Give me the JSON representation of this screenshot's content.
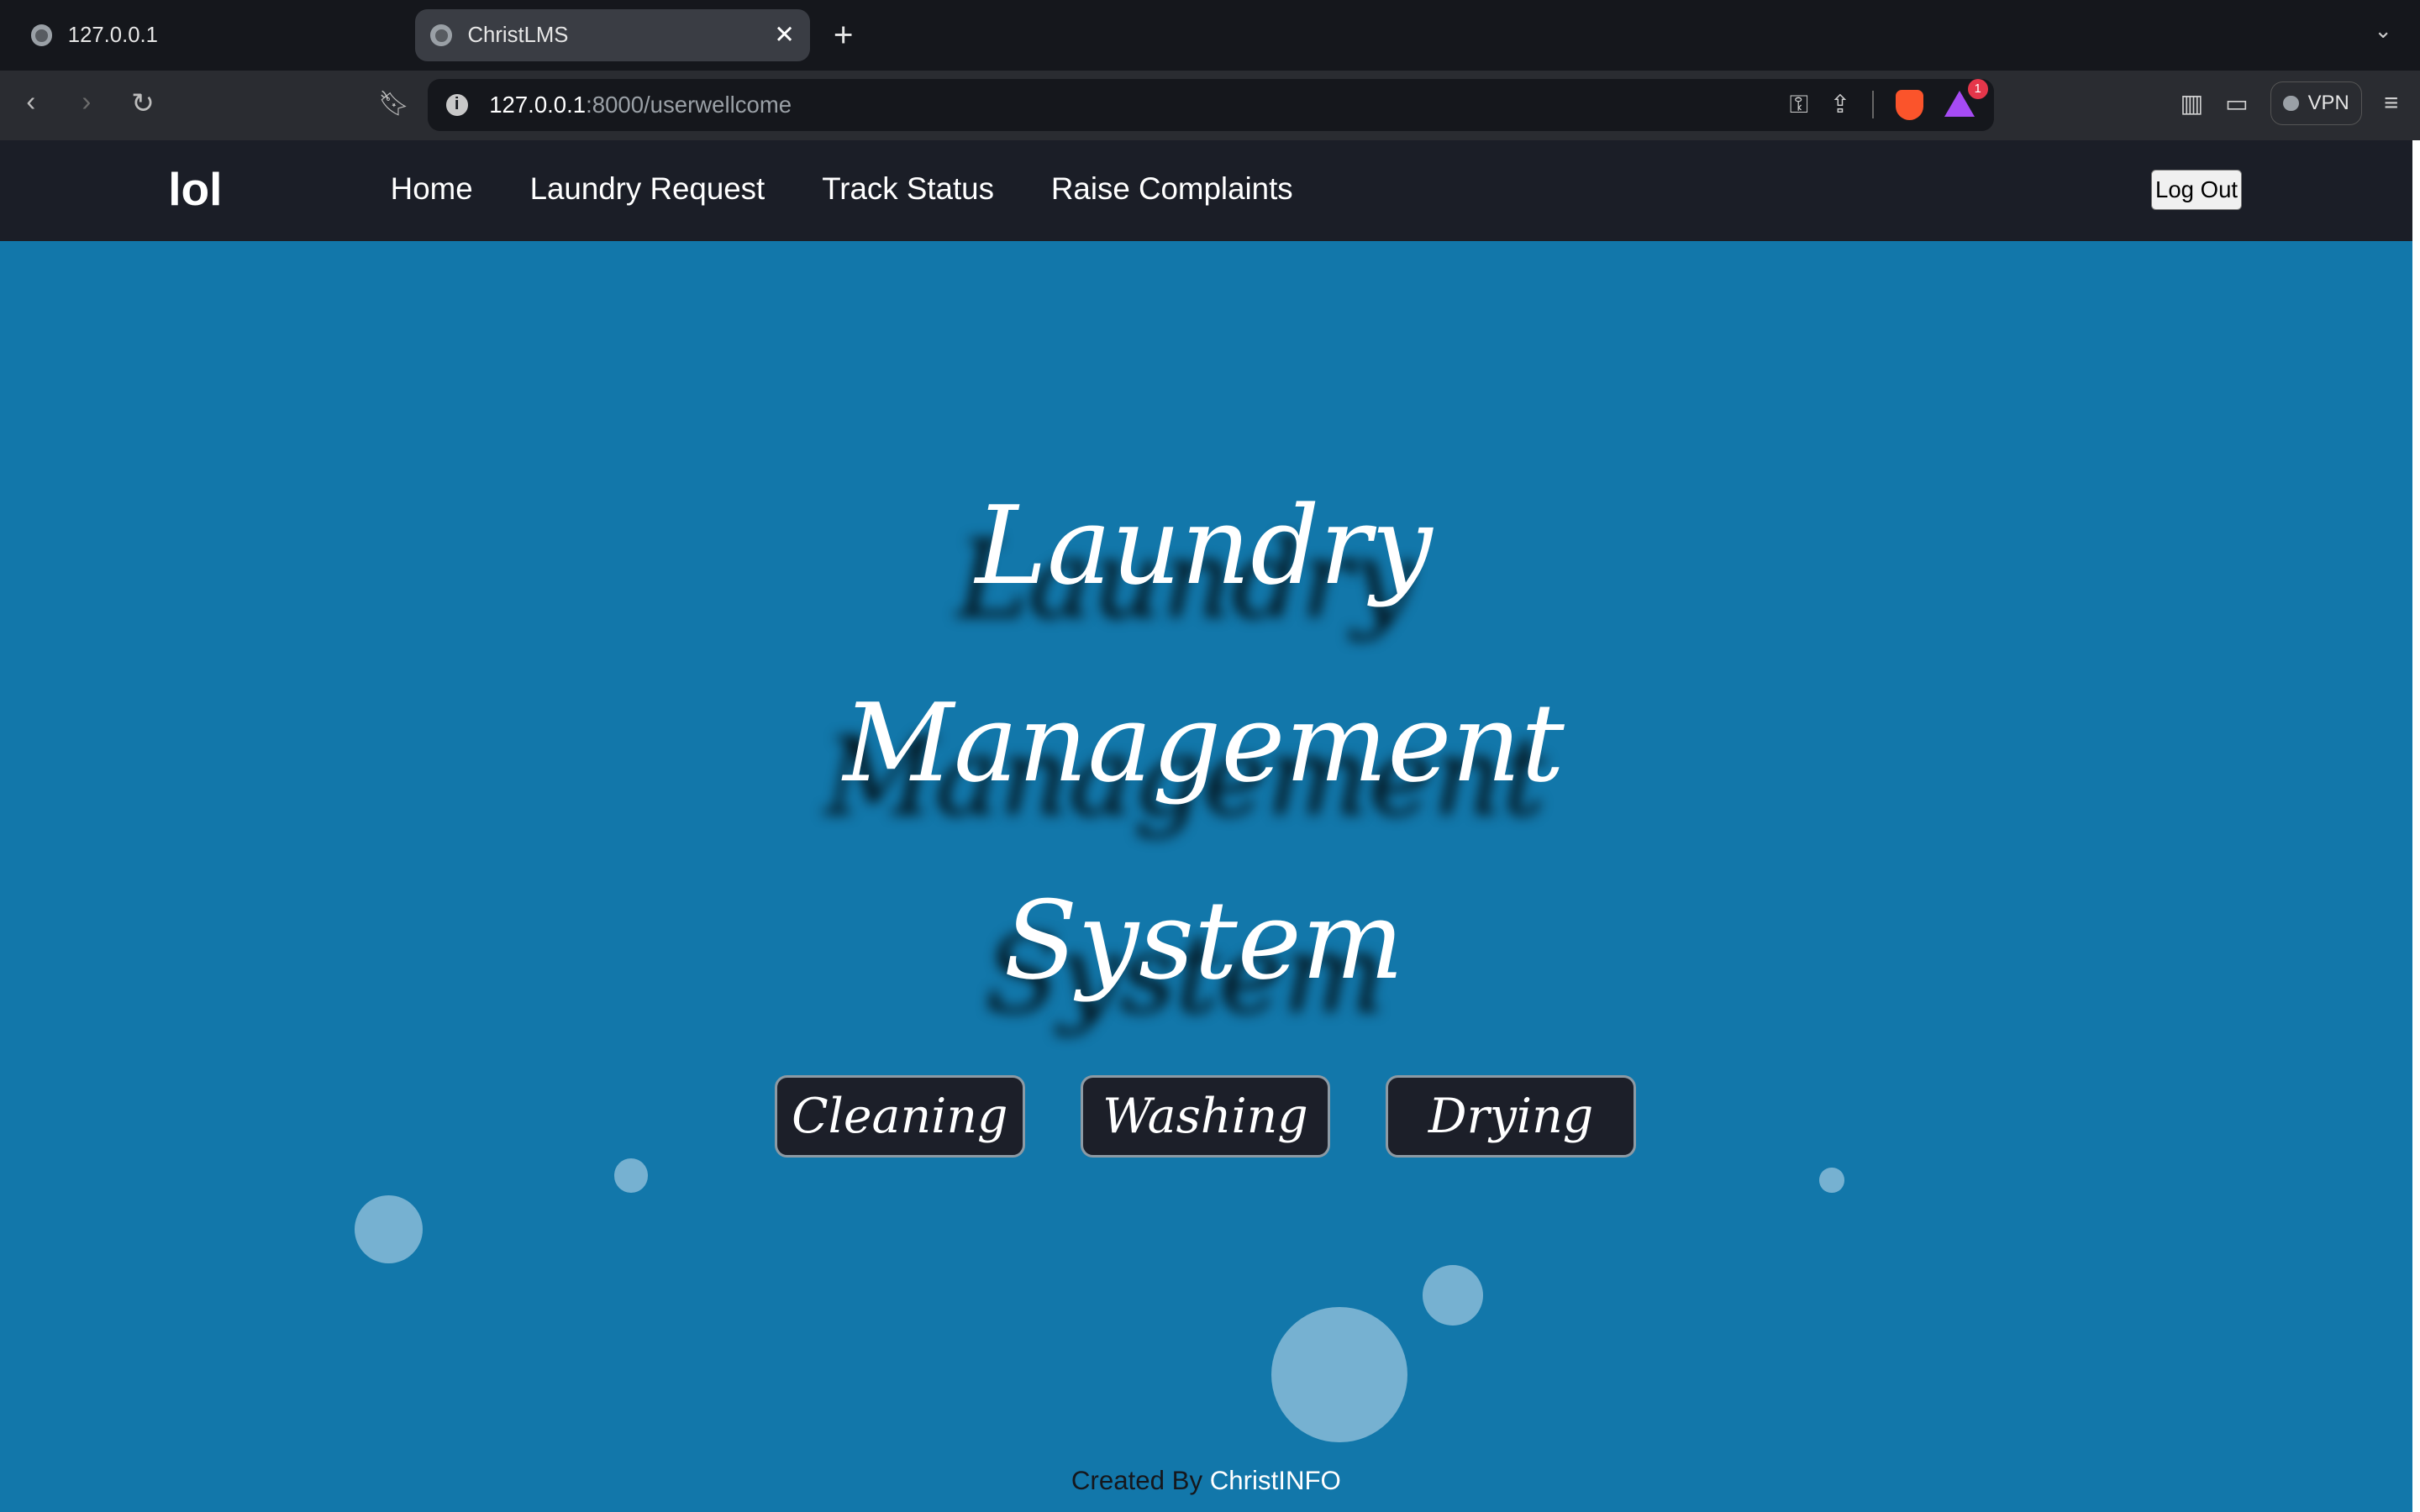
{
  "browser": {
    "tabs": [
      {
        "title": "127.0.0.1",
        "active": false
      },
      {
        "title": "ChristLMS",
        "active": true
      }
    ],
    "url_host": "127.0.0.1",
    "url_path": ":8000/userwellcome",
    "vpn_label": "VPN",
    "rewards_badge": "1"
  },
  "site": {
    "logo": "lol",
    "nav_links": [
      "Home",
      "Laundry Request",
      "Track Status",
      "Raise Complaints"
    ],
    "logout_label": "Log Out"
  },
  "hero": {
    "title_lines": [
      "Laundry",
      "Management",
      "System"
    ],
    "services": [
      "Cleaning",
      "Washing",
      "Drying"
    ]
  },
  "footer": {
    "prefix": "Created By",
    "brand": "ChristINFO"
  },
  "colors": {
    "page_background": "#1277aa",
    "navbar": "#1b1e27",
    "service_button": "#1c1f29"
  }
}
